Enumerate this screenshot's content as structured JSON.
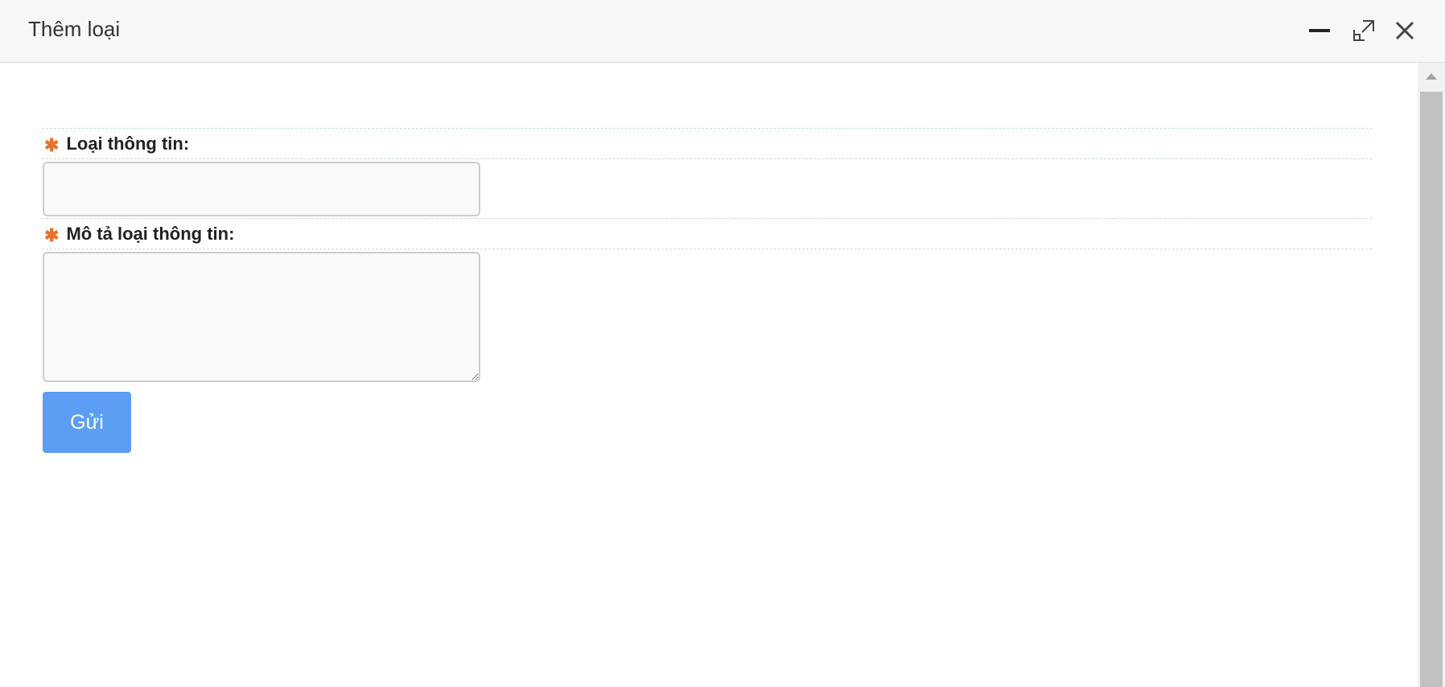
{
  "window": {
    "title": "Thêm loại",
    "controls": {
      "minimize_icon": "minimize-icon",
      "maximize_icon": "maximize-icon",
      "close_icon": "close-icon"
    }
  },
  "form": {
    "fields": [
      {
        "label": "Loại thông tin:",
        "required_marker": "✱",
        "type": "text",
        "value": ""
      },
      {
        "label": "Mô tả loại thông tin:",
        "required_marker": "✱",
        "type": "textarea",
        "value": ""
      }
    ],
    "submit_label": "Gửi"
  },
  "colors": {
    "accent": "#5b9ef4",
    "required": "#e8722a",
    "titlebar_bg": "#f7f7f7",
    "field_bg": "#f9f9f9"
  }
}
